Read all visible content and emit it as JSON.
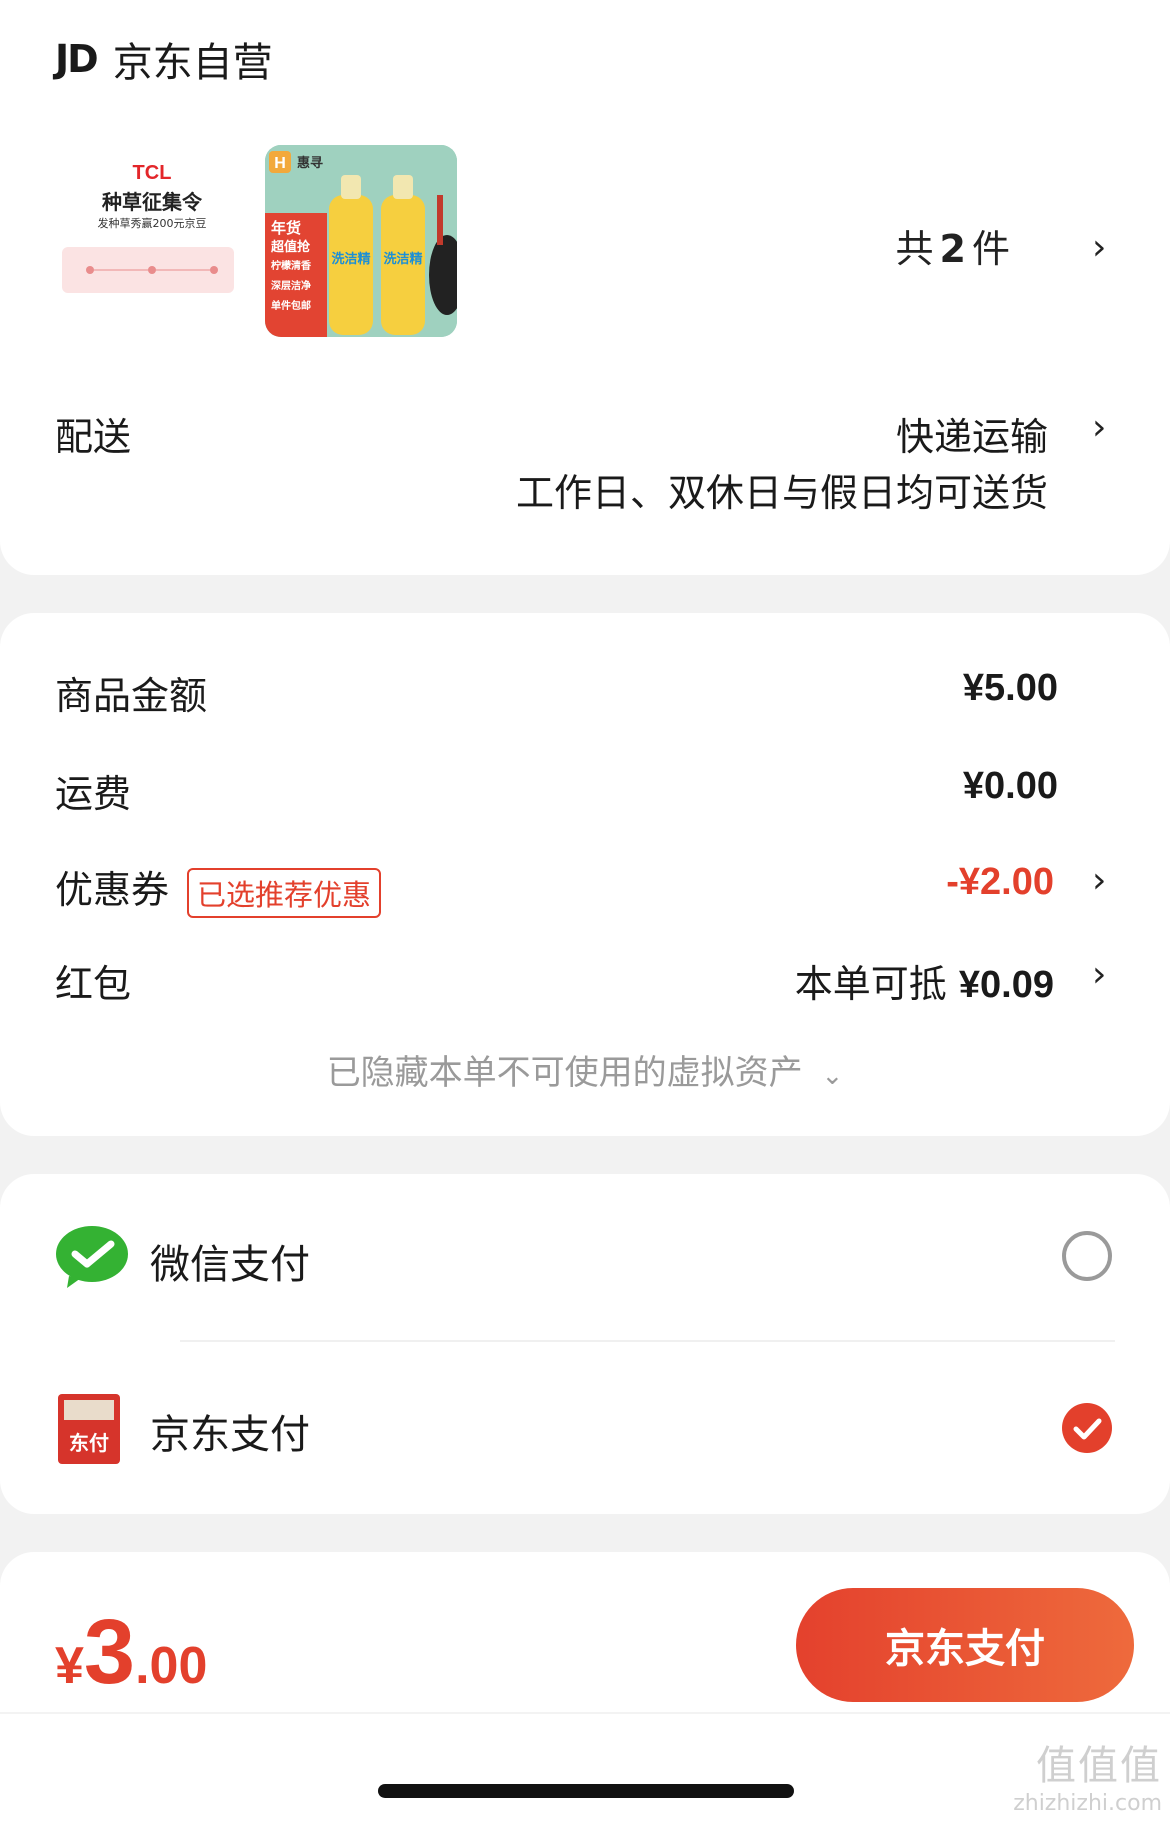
{
  "store": {
    "logo": "JD",
    "name": "京东自营"
  },
  "items": {
    "thumb_a": {
      "brand": "TCL",
      "title": "种草征集令",
      "subtitle": "发种草秀赢200元京豆"
    },
    "thumb_b": {
      "brand": "惠寻",
      "badge_lines": [
        "年货",
        "超值抢",
        "柠檬清香",
        "深层洁净",
        "单件包邮"
      ],
      "product": "洗洁精"
    },
    "count_prefix": "共",
    "count_value": "2",
    "count_suffix": "件"
  },
  "delivery": {
    "label": "配送",
    "method": "快递运输",
    "note": "工作日、双休日与假日均可送货"
  },
  "summary": {
    "goods_label": "商品金额",
    "goods_value": "¥5.00",
    "shipping_label": "运费",
    "shipping_value": "¥0.00",
    "coupon_label": "优惠券",
    "coupon_tag": "已选推荐优惠",
    "coupon_value": "-¥2.00",
    "redpack_label": "红包",
    "redpack_prefix": "本单可抵",
    "redpack_value": "¥0.09",
    "hidden_note": "已隐藏本单不可使用的虚拟资产"
  },
  "payment": {
    "options": [
      {
        "name": "微信支付",
        "selected": false,
        "icon": "wechat-pay-icon"
      },
      {
        "name": "京东支付",
        "selected": true,
        "icon": "jd-pay-icon",
        "icon_text": "东付"
      }
    ]
  },
  "footer": {
    "yen": "¥",
    "total_int": "3",
    "total_dec": ".00",
    "pay_button": "京东支付"
  },
  "watermark": {
    "big": "值值值",
    "small": "zhizhizhi.com"
  },
  "colors": {
    "accent": "#e3402c",
    "wechat": "#34b233",
    "jdpay": "#d6342b"
  }
}
